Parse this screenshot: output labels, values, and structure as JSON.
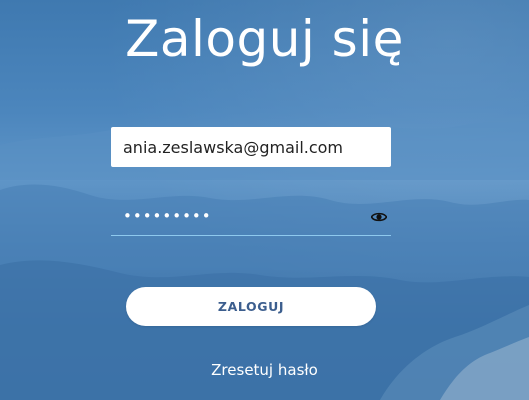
{
  "page": {
    "title": "Zaloguj się"
  },
  "form": {
    "email_value": "ania.zeslawska@gmail.com",
    "password_value": "•••••••••",
    "login_button_label": "ZALOGUJ",
    "reset_link_label": "Zresetuj hasło"
  },
  "icons": {
    "password_toggle": "eye-icon"
  },
  "colors": {
    "background": "#3f79b1",
    "button_text": "#3c5e8e",
    "field_underline": "#8ec9ee"
  }
}
